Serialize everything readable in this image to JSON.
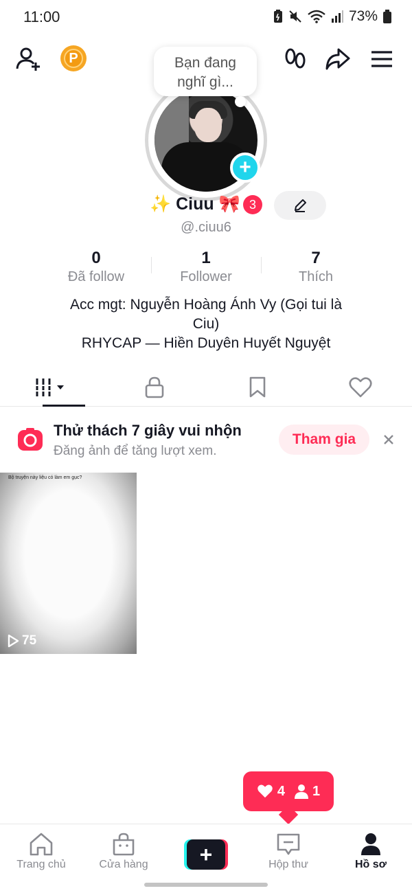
{
  "status_bar": {
    "time": "11:00",
    "battery": "73%"
  },
  "thought_bubble": {
    "text_line1": "Bạn đang",
    "text_line2": "nghĩ gì..."
  },
  "profile": {
    "display_name": "✨ Ciuu 🎀",
    "notification_count": "3",
    "username": "@.ciuu6",
    "add_badge": "+"
  },
  "stats": [
    {
      "value": "0",
      "label": "Đã follow"
    },
    {
      "value": "1",
      "label": "Follower"
    },
    {
      "value": "7",
      "label": "Thích"
    }
  ],
  "bio": {
    "line1": "Acc mgt: Nguyễn Hoàng Ánh Vy (Gọi tui là",
    "line2": "Ciu)",
    "line3": "RHYCAP — Hiền Duyên Huyết Nguyệt"
  },
  "challenge": {
    "title": "Thử thách 7 giây vui nhộn",
    "subtitle": "Đăng ảnh để tăng lượt xem.",
    "join_label": "Tham gia"
  },
  "videos": [
    {
      "caption": "Bộ truyện này liệu có làm em gục?",
      "views": "75"
    }
  ],
  "activity_popup": {
    "likes": "4",
    "followers": "1"
  },
  "bottom_nav": {
    "home": "Trang chủ",
    "shop": "Cửa hàng",
    "create": "+",
    "inbox": "Hộp thư",
    "profile": "Hồ sơ"
  },
  "colors": {
    "accent": "#fe2c55",
    "cyan": "#20d5ec",
    "coin": "#f6a623"
  }
}
